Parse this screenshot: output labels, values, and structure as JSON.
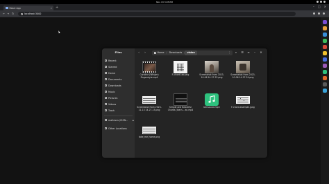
{
  "system": {
    "clock": "Nov 13  3:05 PM"
  },
  "browser": {
    "tab_title": "React App",
    "url": "localhost:3000"
  },
  "files": {
    "app_title": "Files",
    "sidebar": [
      {
        "label": "Recent",
        "icon": "clock-icon"
      },
      {
        "label": "Starred",
        "icon": "star-icon"
      },
      {
        "label": "Home",
        "icon": "home-icon"
      },
      {
        "label": "Documents",
        "icon": "document-icon"
      },
      {
        "label": "Downloads",
        "icon": "download-icon"
      },
      {
        "label": "Music",
        "icon": "music-icon"
      },
      {
        "label": "Pictures",
        "icon": "picture-icon"
      },
      {
        "label": "Videos",
        "icon": "video-icon"
      },
      {
        "label": "Trash",
        "icon": "trash-icon"
      },
      {
        "label": "mallesvs (ISSN...",
        "icon": "drive-icon"
      },
      {
        "label": "Other Locations",
        "icon": "plus-icon"
      }
    ],
    "path": [
      "Home",
      "Downloads",
      "vision"
    ],
    "items": [
      {
        "name": "Caroline (Winger) Fingerstyle.mp4",
        "kind": "video"
      },
      {
        "name": "F-chord-tab.png",
        "kind": "chord"
      },
      {
        "name": "Screenshot from 2023-10-06 14-27-22.png",
        "kind": "photo"
      },
      {
        "name": "Screenshot from 2023-10-06 14-27-24.png",
        "kind": "photo2"
      },
      {
        "name": "Screenshot from 2023-11-13 14-27-15.png",
        "kind": "sheet"
      },
      {
        "name": "Simple and Beautiful Chords (learn... an.mp4",
        "kind": "video2"
      },
      {
        "name": "bensound.mp3",
        "kind": "music"
      },
      {
        "name": "F-chord-example.jpeg",
        "kind": "chord2"
      },
      {
        "name": "take_me_home.png",
        "kind": "sheet"
      }
    ]
  }
}
